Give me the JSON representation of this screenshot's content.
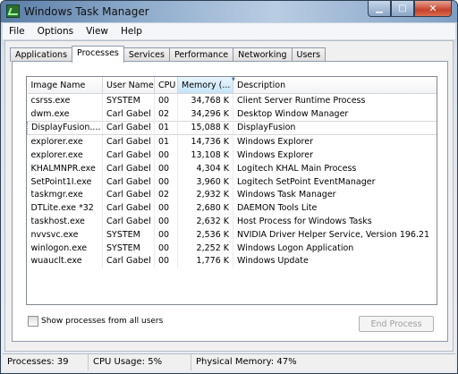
{
  "window": {
    "title": "Windows Task Manager",
    "close_glyph": "✕",
    "min_glyph": "▁",
    "max_glyph": "□"
  },
  "menu": [
    "File",
    "Options",
    "View",
    "Help"
  ],
  "tabs": [
    "Applications",
    "Processes",
    "Services",
    "Performance",
    "Networking",
    "Users"
  ],
  "columns": [
    "Image Name",
    "User Name",
    "CPU",
    "Memory (...",
    "Description"
  ],
  "rows": [
    [
      "csrss.exe",
      "SYSTEM",
      "00",
      "34,768 K",
      "Client Server Runtime Process"
    ],
    [
      "dwm.exe",
      "Carl Gabel",
      "02",
      "34,296 K",
      "Desktop Window Manager"
    ],
    [
      "DisplayFusion....",
      "Carl Gabel",
      "01",
      "15,088 K",
      "DisplayFusion"
    ],
    [
      "explorer.exe",
      "Carl Gabel",
      "01",
      "14,736 K",
      "Windows Explorer"
    ],
    [
      "explorer.exe",
      "Carl Gabel",
      "00",
      "13,108 K",
      "Windows Explorer"
    ],
    [
      "KHALMNPR.exe",
      "Carl Gabel",
      "00",
      "4,304 K",
      "Logitech KHAL Main Process"
    ],
    [
      "SetPoint1I.exe",
      "Carl Gabel",
      "00",
      "3,960 K",
      "Logitech SetPoint EventManager"
    ],
    [
      "taskmgr.exe",
      "Carl Gabel",
      "02",
      "2,932 K",
      "Windows Task Manager"
    ],
    [
      "DTLite.exe *32",
      "Carl Gabel",
      "00",
      "2,680 K",
      "DAEMON Tools Lite"
    ],
    [
      "taskhost.exe",
      "Carl Gabel",
      "00",
      "2,632 K",
      "Host Process for Windows Tasks"
    ],
    [
      "nvvsvc.exe",
      "SYSTEM",
      "00",
      "2,536 K",
      "NVIDIA Driver Helper Service, Version 196.21"
    ],
    [
      "winlogon.exe",
      "SYSTEM",
      "00",
      "2,252 K",
      "Windows Logon Application"
    ],
    [
      "wuauclt.exe",
      "Carl Gabel",
      "00",
      "1,776 K",
      "Windows Update"
    ]
  ],
  "selected_row": 2,
  "show_all_label": "Show processes from all users",
  "end_process_label": "End Process",
  "status": {
    "processes": "Processes: 39",
    "cpu": "CPU Usage: 5%",
    "memory": "Physical Memory: 47%"
  }
}
